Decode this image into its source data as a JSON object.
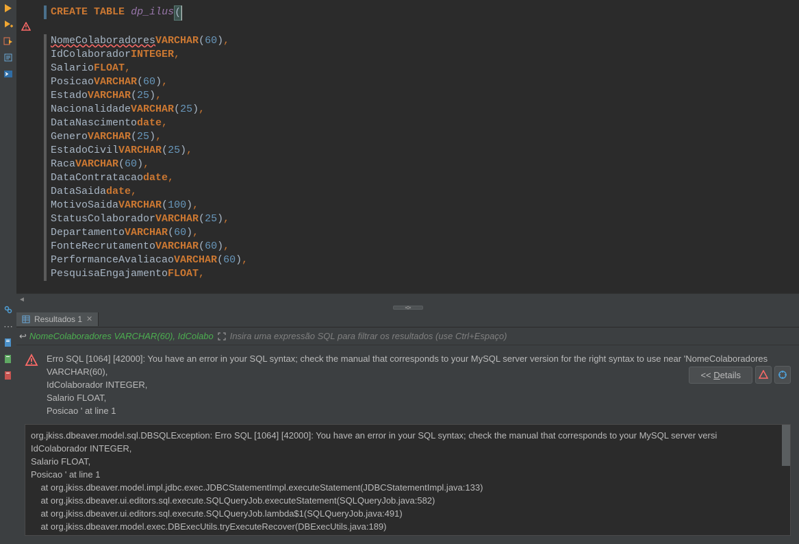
{
  "editor": {
    "line1": {
      "kw1": "CREATE",
      "kw2": "TABLE",
      "name": "dp_ilus",
      "paren": "("
    },
    "columns": [
      {
        "name": "NomeColaboradores",
        "type": "VARCHAR",
        "size": "60",
        "error": true
      },
      {
        "name": "IdColaborador",
        "type": "INTEGER",
        "size": null
      },
      {
        "name": "Salario",
        "type": "FLOAT",
        "size": null
      },
      {
        "name": "Posicao",
        "type": "VARCHAR",
        "size": "60"
      },
      {
        "name": "Estado",
        "type": "VARCHAR",
        "size": "25"
      },
      {
        "name": "Nacionalidade",
        "type": "VARCHAR",
        "size": "25"
      },
      {
        "name": "DataNascimento",
        "type": "date",
        "size": null
      },
      {
        "name": "Genero",
        "type": "VARCHAR",
        "size": "25"
      },
      {
        "name": "EstadoCivil",
        "type": "VARCHAR",
        "size": "25"
      },
      {
        "name": "Raca",
        "type": "VARCHAR",
        "size": "60"
      },
      {
        "name": "DataContratacao",
        "type": "date",
        "size": null
      },
      {
        "name": "DataSaida",
        "type": "date",
        "size": null
      },
      {
        "name": "MotivoSaida",
        "type": "VARCHAR",
        "size": "100"
      },
      {
        "name": "StatusColaborador",
        "type": "VARCHAR",
        "size": "25"
      },
      {
        "name": "Departamento",
        "type": "VARCHAR",
        "size": "60"
      },
      {
        "name": "FonteRecrutamento",
        "type": "VARCHAR",
        "size": "60"
      },
      {
        "name": "PerformanceAvaliacao",
        "type": "VARCHAR",
        "size": "60"
      },
      {
        "name": "PesquisaEngajamento",
        "type": "FLOAT",
        "size": null
      }
    ]
  },
  "results": {
    "tab_label": "Resultados 1",
    "header_text": "NomeColaboradores VARCHAR(60), IdColabo",
    "header_arrow": "↩",
    "filter_placeholder": "Insira uma expressão SQL para filtrar os resultados (use Ctrl+Espaço)",
    "error_message": "Erro SQL [1064] [42000]: You have an error in your SQL syntax; check the manual that corresponds to your MySQL server version for the right syntax to use near 'NomeColaboradores VARCHAR(60),\nIdColaborador INTEGER,\nSalario FLOAT,\nPosicao ' at line 1",
    "details_label_prefix": "<< ",
    "details_label_underline": "D",
    "details_label_suffix": "etails",
    "stacktrace": "org.jkiss.dbeaver.model.sql.DBSQLException: Erro SQL [1064] [42000]: You have an error in your SQL syntax; check the manual that corresponds to your MySQL server versi\nIdColaborador INTEGER,\nSalario FLOAT,\nPosicao ' at line 1\n    at org.jkiss.dbeaver.model.impl.jdbc.exec.JDBCStatementImpl.executeStatement(JDBCStatementImpl.java:133)\n    at org.jkiss.dbeaver.ui.editors.sql.execute.SQLQueryJob.executeStatement(SQLQueryJob.java:582)\n    at org.jkiss.dbeaver.ui.editors.sql.execute.SQLQueryJob.lambda$1(SQLQueryJob.java:491)\n    at org.jkiss.dbeaver.model.exec.DBExecUtils.tryExecuteRecover(DBExecUtils.java:189)"
  }
}
